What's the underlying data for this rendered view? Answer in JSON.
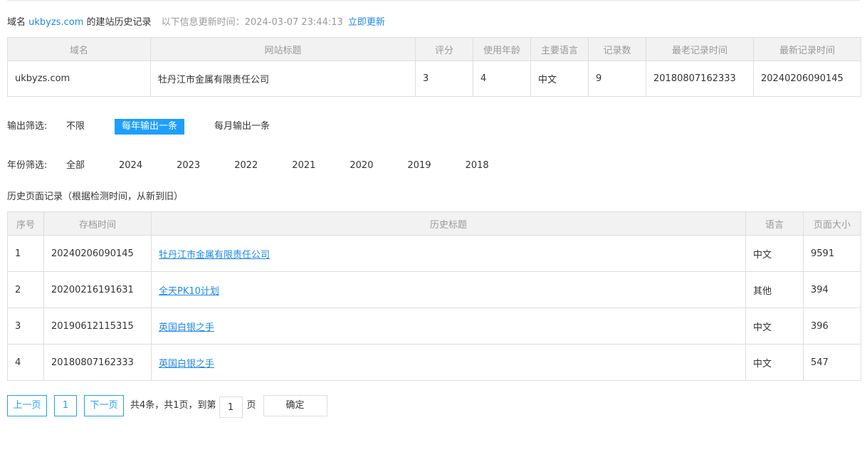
{
  "header": {
    "prefix": "域名",
    "domain": "ukbyzs.com",
    "suffix": "的建站历史记录",
    "update_label": "以下信息更新时间：",
    "update_time": "2024-03-07 23:44:13",
    "update_link": "立即更新"
  },
  "info_table": {
    "headers": [
      "域名",
      "网站标题",
      "评分",
      "使用年龄",
      "主要语言",
      "记录数",
      "最老记录时间",
      "最新记录时间"
    ],
    "row": [
      "ukbyzs.com",
      "牡丹江市金属有限责任公司",
      "3",
      "4",
      "中文",
      "9",
      "20180807162333",
      "20240206090145"
    ]
  },
  "output_filter": {
    "label": "输出筛选:",
    "options": [
      "不限",
      "每年输出一条",
      "每月输出一条"
    ],
    "active": 1
  },
  "year_filter": {
    "label": "年份筛选:",
    "options": [
      "全部",
      "2024",
      "2023",
      "2022",
      "2021",
      "2020",
      "2019",
      "2018"
    ]
  },
  "history": {
    "title": "历史页面记录（根据检测时间，从新到旧）",
    "headers": [
      "序号",
      "存档时间",
      "历史标题",
      "语言",
      "页面大小"
    ],
    "rows": [
      [
        "1",
        "20240206090145",
        "牡丹江市金属有限责任公司",
        "中文",
        "9591"
      ],
      [
        "2",
        "20200216191631",
        "全天PK10计划",
        "其他",
        "394"
      ],
      [
        "3",
        "20190612115315",
        "英国白银之手",
        "中文",
        "396"
      ],
      [
        "4",
        "20180807162333",
        "英国白银之手",
        "中文",
        "547"
      ]
    ]
  },
  "pager": {
    "prev": "上一页",
    "current": "1",
    "next": "下一页",
    "summary": "共4条，共1页，到第",
    "goto_value": "1",
    "page_unit": "页",
    "confirm": "确定"
  },
  "colors": {
    "accent": "#1e9fff",
    "link": "#1e88e5",
    "header_bg": "#f2f2f2",
    "border": "#dddddd"
  }
}
